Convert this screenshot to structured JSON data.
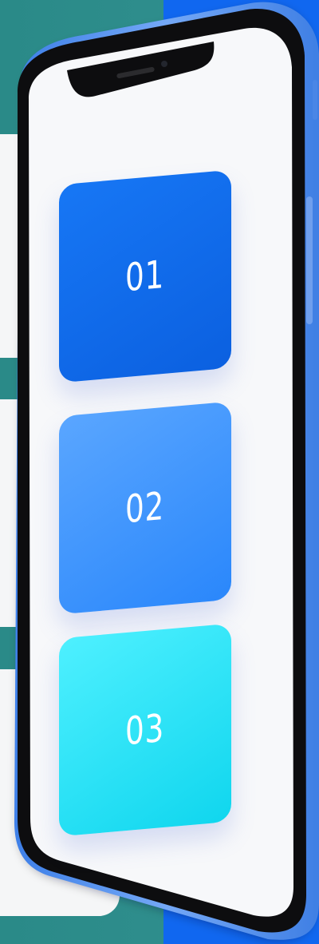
{
  "cards": [
    {
      "label": "01",
      "color_start": "#1777f5",
      "color_end": "#0b60e0"
    },
    {
      "label": "02",
      "color_start": "#5aa6ff",
      "color_end": "#2a87fb"
    },
    {
      "label": "03",
      "color_start": "#4ef0ff",
      "color_end": "#10d6ee"
    }
  ],
  "colors": {
    "background_teal": "#2f8e8d",
    "background_blue": "#1067f0",
    "phone_bezel": "#111111",
    "phone_side": "#5b95f2",
    "screen": "#f7f8fa"
  },
  "icons": {
    "speaker": "speaker-grille-icon",
    "camera": "front-camera-icon",
    "side_button": "side-button-icon"
  }
}
